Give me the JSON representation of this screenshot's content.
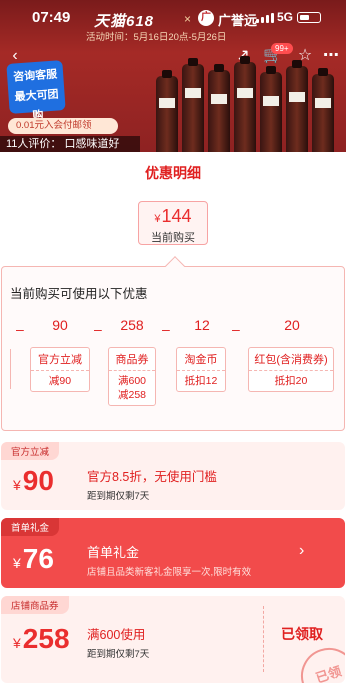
{
  "status_bar": {
    "time": "07:49",
    "network": "5G"
  },
  "promo": {
    "brand": "天猫618",
    "x": "×",
    "store_logo": "广",
    "store": "广誉远",
    "time_text": "活动时间：5月16日20点-5月26日"
  },
  "nav": {
    "back": "‹",
    "share": "↗",
    "cart": "🛒",
    "cart_badge": "99+",
    "favorite": "☆",
    "more": "⋯"
  },
  "product": {
    "promo_tag_line1": "咨询客服",
    "promo_tag_line2": "最大可团购",
    "member_tag": "0.01元入会付邮领",
    "review_text": "11人评价：  口感味道好"
  },
  "sheet": {
    "title": "优惠明细",
    "current": {
      "currency": "¥",
      "price": "144",
      "label": "当前购买"
    },
    "panel_title": "当前购买可使用以下优惠",
    "minus": "–",
    "breakdown": [
      {
        "value": "90",
        "name": "官方立减",
        "detail_line1": "减90",
        "detail_line2": ""
      },
      {
        "value": "258",
        "name": "商品券",
        "detail_line1": "满600",
        "detail_line2": "减258"
      },
      {
        "value": "12",
        "name": "淘金币",
        "detail_line1": "抵扣12",
        "detail_line2": ""
      },
      {
        "value": "20",
        "name": "红包(含消费券)",
        "detail_line1": "抵扣20",
        "detail_line2": ""
      }
    ]
  },
  "coupons": [
    {
      "tag": "官方立减",
      "currency": "¥",
      "amount": "90",
      "desc": "官方8.5折，无使用门槛",
      "sub": "距到期仅剩7天"
    },
    {
      "tag": "首单礼金",
      "currency": "¥",
      "amount": "76",
      "desc": "首单礼金",
      "sub": "店铺且品类新客礼金限享一次,限时有效",
      "chevron": "›"
    },
    {
      "tag": "店铺商品券",
      "currency": "¥",
      "amount": "258",
      "desc": "满600使用",
      "sub": "距到期仅剩7天",
      "status": "已领取",
      "stamp": "已领"
    }
  ],
  "colors": {
    "accent": "#e02020",
    "card_highlight": "#f24b4b",
    "panel_border": "#f5b6b2"
  }
}
